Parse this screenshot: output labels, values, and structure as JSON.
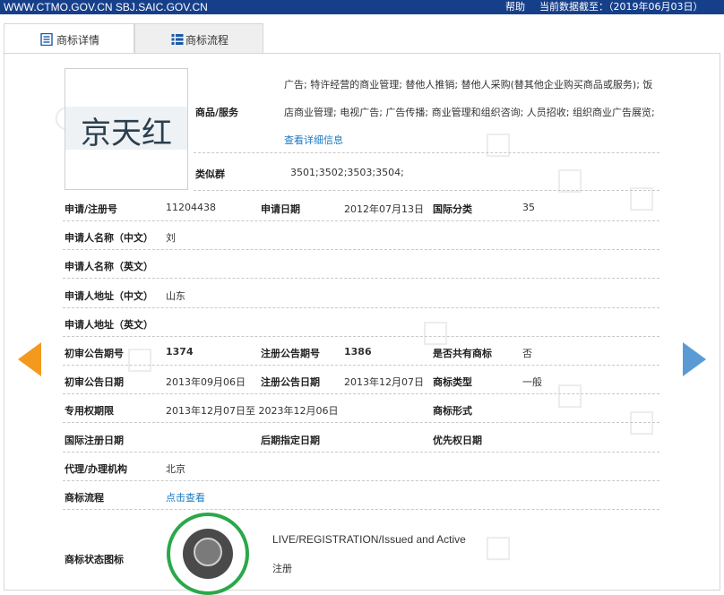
{
  "topbar": {
    "site": "WWW.CTMO.GOV.CN SBJ.SAIC.GOV.CN",
    "help": "帮助",
    "data_date": "当前数据截至：（2019年06月03日）"
  },
  "tabs": [
    {
      "label": "商标详情"
    },
    {
      "label": "商标流程"
    }
  ],
  "logo": {
    "text": "京天红"
  },
  "goods": {
    "label": "商品/服务",
    "line1": "广告; 特许经营的商业管理; 替他人推销; 替他人采购(替其他企业购买商品或服务); 饭",
    "line2": "店商业管理; 电视广告; 广告传播; 商业管理和组织咨询; 人员招收; 组织商业广告展览;",
    "more_link": "查看详细信息"
  },
  "similar_group": {
    "label": "类似群",
    "value": "3501;3502;3503;3504;"
  },
  "rows": {
    "reg_no": {
      "label": "申请/注册号",
      "value": "11204438"
    },
    "app_date": {
      "label": "申请日期",
      "value": "2012年07月13日"
    },
    "intl_class": {
      "label": "国际分类",
      "value": "35"
    },
    "applicant_cn": {
      "label": "申请人名称（中文）",
      "value": "刘"
    },
    "applicant_en": {
      "label": "申请人名称（英文）",
      "value": ""
    },
    "address_cn": {
      "label": "申请人地址（中文）",
      "value": "山东"
    },
    "address_en": {
      "label": "申请人地址（英文）",
      "value": ""
    },
    "prelim_no": {
      "label": "初审公告期号",
      "value": "1374"
    },
    "reg_pub_no": {
      "label": "注册公告期号",
      "value": "1386"
    },
    "shared": {
      "label": "是否共有商标",
      "value": "否"
    },
    "prelim_date": {
      "label": "初审公告日期",
      "value": "2013年09月06日"
    },
    "reg_pub_date": {
      "label": "注册公告日期",
      "value": "2013年12月07日"
    },
    "tm_type": {
      "label": "商标类型",
      "value": "一般"
    },
    "exclusive": {
      "label": "专用权期限",
      "value": "2013年12月07日至 2023年12月06日"
    },
    "tm_form": {
      "label": "商标形式",
      "value": ""
    },
    "intl_reg_date": {
      "label": "国际注册日期",
      "value": ""
    },
    "later_date": {
      "label": "后期指定日期",
      "value": ""
    },
    "priority_date": {
      "label": "优先权日期",
      "value": ""
    },
    "agent": {
      "label": "代理/办理机构",
      "value": "北京"
    },
    "flow": {
      "label": "商标流程",
      "link": "点击查看"
    }
  },
  "status": {
    "label": "商标状态图标",
    "en": "LIVE/REGISTRATION/Issued and Active",
    "cn": "注册"
  },
  "colors": {
    "topbar": "#163f8a",
    "link": "#1a78c2",
    "prev_arrow": "#f39a1e",
    "next_arrow": "#5b9bd5",
    "badge_ring": "#2aa84a"
  }
}
